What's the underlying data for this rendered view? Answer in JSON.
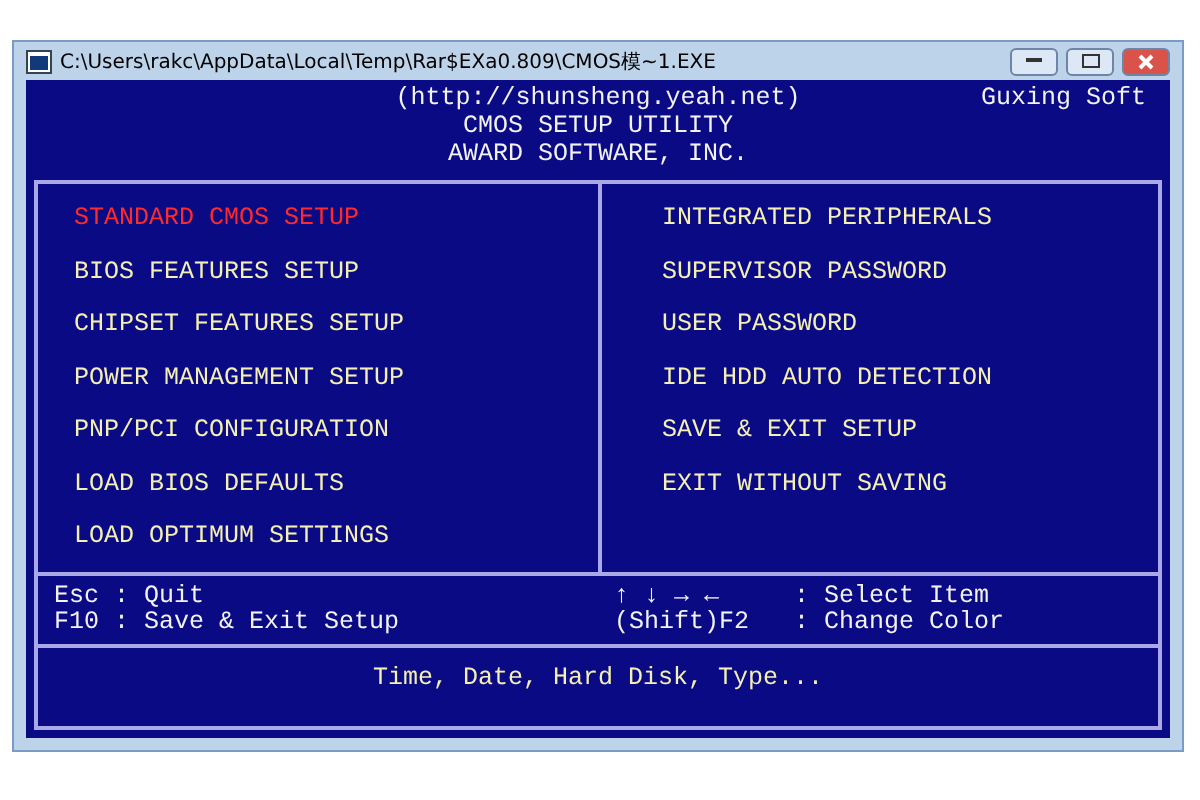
{
  "window": {
    "title": "C:\\Users\\rakc\\AppData\\Local\\Temp\\Rar$EXa0.809\\CMOS模~1.EXE"
  },
  "header": {
    "url": "(http://shunsheng.yeah.net)",
    "vendor": "Guxing Soft",
    "title": "CMOS SETUP UTILITY",
    "company": "AWARD SOFTWARE, INC."
  },
  "menu_left": [
    {
      "label": "STANDARD CMOS SETUP",
      "selected": true
    },
    {
      "label": "BIOS FEATURES SETUP",
      "selected": false
    },
    {
      "label": "CHIPSET FEATURES SETUP",
      "selected": false
    },
    {
      "label": "POWER MANAGEMENT SETUP",
      "selected": false
    },
    {
      "label": "PNP/PCI CONFIGURATION",
      "selected": false
    },
    {
      "label": "LOAD BIOS DEFAULTS",
      "selected": false
    },
    {
      "label": "LOAD OPTIMUM SETTINGS",
      "selected": false
    }
  ],
  "menu_right": [
    {
      "label": "INTEGRATED PERIPHERALS",
      "selected": false
    },
    {
      "label": "SUPERVISOR PASSWORD",
      "selected": false
    },
    {
      "label": "USER PASSWORD",
      "selected": false
    },
    {
      "label": "IDE HDD AUTO DETECTION",
      "selected": false
    },
    {
      "label": "SAVE & EXIT SETUP",
      "selected": false
    },
    {
      "label": "EXIT WITHOUT SAVING",
      "selected": false
    }
  ],
  "help_left": [
    "Esc : Quit",
    "F10 : Save & Exit Setup"
  ],
  "help_right": [
    {
      "key": "↑ ↓ → ←",
      "action": ": Select Item"
    },
    {
      "key": "(Shift)F2",
      "action": ": Change Color"
    }
  ],
  "status": "Time, Date, Hard Disk, Type..."
}
